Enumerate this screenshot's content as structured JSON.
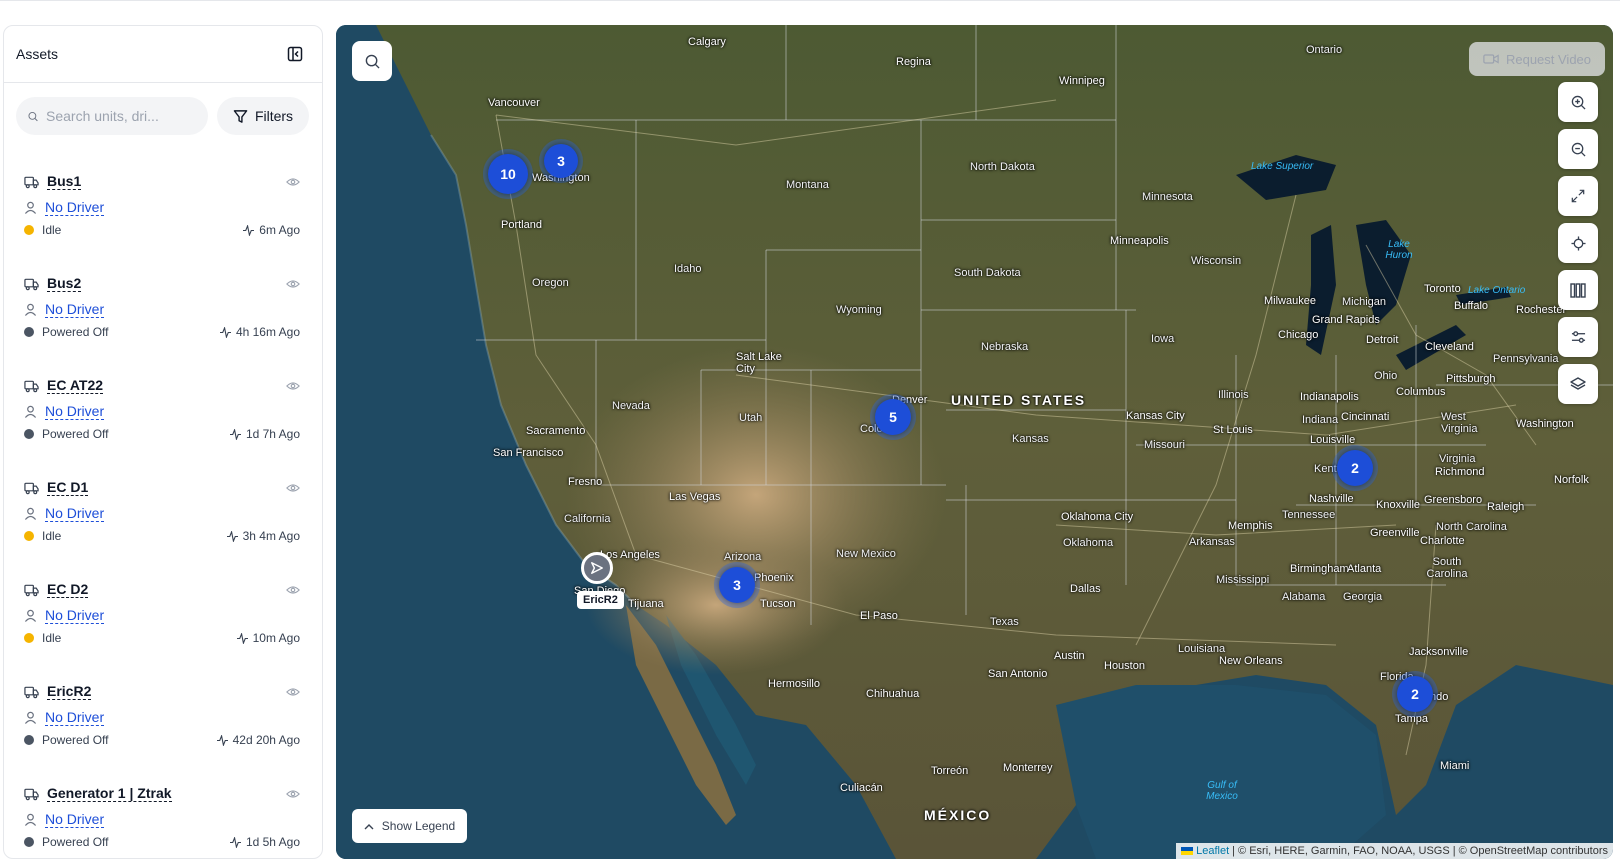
{
  "sidebar": {
    "title": "Assets",
    "search_placeholder": "Search units, dri...",
    "filters_label": "Filters",
    "assets": [
      {
        "name": "Bus1",
        "driver": "No Driver",
        "status": "Idle",
        "ago": "6m Ago"
      },
      {
        "name": "Bus2",
        "driver": "No Driver",
        "status": "Powered Off",
        "ago": "4h 16m Ago"
      },
      {
        "name": "EC AT22",
        "driver": "No Driver",
        "status": "Powered Off",
        "ago": "1d 7h Ago"
      },
      {
        "name": "EC D1",
        "driver": "No Driver",
        "status": "Idle",
        "ago": "3h 4m Ago"
      },
      {
        "name": "EC D2",
        "driver": "No Driver",
        "status": "Idle",
        "ago": "10m Ago"
      },
      {
        "name": "EricR2",
        "driver": "No Driver",
        "status": "Powered Off",
        "ago": "42d 20h Ago"
      },
      {
        "name": "Generator 1 | Ztrak",
        "driver": "No Driver",
        "status": "Powered Off",
        "ago": "1d 5h Ago"
      }
    ],
    "status_colors": {
      "Idle": "#f5b400",
      "Powered Off": "#4b5563"
    }
  },
  "map": {
    "request_video_label": "Request Video",
    "show_legend_label": "Show Legend",
    "vehicle_label": "EricR2",
    "clusters": [
      "10",
      "3",
      "5",
      "2",
      "3",
      "2"
    ],
    "country_label": "UNITED STATES",
    "mexico_label": "MÉXICO",
    "attribution_leaflet": "Leaflet",
    "attribution_text": "| © Esri, HERE, Garmin, FAO, NOAA, USGS | © OpenStreetMap contributors",
    "controls": [
      "zoom-in-icon",
      "zoom-out-icon",
      "fullscreen-icon",
      "locate-icon",
      "map-style-icon",
      "settings-sliders-icon",
      "layers-icon"
    ],
    "places": {
      "calgary": "Calgary",
      "regina": "Regina",
      "winnipeg": "Winnipeg",
      "ontario": "Ontario",
      "vancouver": "Vancouver",
      "washington": "Washington",
      "portland": "Portland",
      "oregon": "Oregon",
      "idaho": "Idaho",
      "montana": "Montana",
      "north_dakota": "North Dakota",
      "minnesota": "Minnesota",
      "lake_superior": "Lake Superior",
      "lake_huron": "Lake Huron",
      "lake_ontario": "Lake Ontario",
      "wyoming": "Wyoming",
      "south_dakota": "South Dakota",
      "wisconsin": "Wisconsin",
      "minneapolis": "Minneapolis",
      "toronto": "Toronto",
      "buffalo": "Buffalo",
      "rochester": "Rochester",
      "milwaukee": "Milwaukee",
      "michigan": "Michigan",
      "grand_rapids": "Grand Rapids",
      "detroit": "Detroit",
      "chicago": "Chicago",
      "cleveland": "Cleveland",
      "pennsylvania": "Pennsylvania",
      "salt_lake_city": "Salt Lake City",
      "nebraska": "Nebraska",
      "iowa": "Iowa",
      "ohio": "Ohio",
      "pittsburgh": "Pittsburgh",
      "illinois": "Illinois",
      "indianapolis": "Indianapolis",
      "columbus": "Columbus",
      "nevada": "Nevada",
      "utah": "Utah",
      "denver": "Denver",
      "colorado": "Colo",
      "kansas_city": "Kansas City",
      "indiana": "Indiana",
      "cincinnati": "Cincinnati",
      "west_virginia": "West Virginia",
      "washington_dc": "Washington",
      "sacramento": "Sacramento",
      "san_francisco": "San Francisco",
      "kansas": "Kansas",
      "missouri": "Missouri",
      "st_louis": "St Louis",
      "louisville": "Louisville",
      "virginia": "Virginia",
      "richmond": "Richmond",
      "kentucky": "Kentucky",
      "fresno": "Fresno",
      "las_vegas": "Las Vegas",
      "nashville": "Nashville",
      "knoxville": "Knoxville",
      "greensboro": "Greensboro",
      "raleigh": "Raleigh",
      "norfolk": "Norfolk",
      "california": "California",
      "oklahoma_city": "Oklahoma City",
      "tennessee": "Tennessee",
      "memphis": "Memphis",
      "north_carolina": "North Carolina",
      "los_angeles": "Los Angeles",
      "oklahoma": "Oklahoma",
      "arkansas": "Arkansas",
      "greenville": "Greenville",
      "charlotte": "Charlotte",
      "arizona": "Arizona",
      "phoenix": "Phoenix",
      "new_mexico": "New Mexico",
      "south_carolina": "South Carolina",
      "san_diego": "San Diego",
      "tijuana": "Tijuana",
      "tucson": "Tucson",
      "el_paso": "El Paso",
      "mississippi": "Mississippi",
      "birmingham": "Birmingham",
      "atlanta": "Atlanta",
      "dallas": "Dallas",
      "alabama": "Alabama",
      "georgia": "Georgia",
      "texas": "Texas",
      "louisiana": "Louisiana",
      "jacksonville": "Jacksonville",
      "austin": "Austin",
      "new_orleans": "New Orleans",
      "hermosillo": "Hermosillo",
      "houston": "Houston",
      "san_antonio": "San Antonio",
      "florida": "Florida",
      "orlando": "ndo",
      "chihuahua": "Chihuahua",
      "tampa": "Tampa",
      "torreon": "Torreón",
      "monterrey": "Monterrey",
      "gulf_of_mexico": "Gulf of Mexico",
      "miami": "Miami",
      "culiacan": "Culiacán"
    }
  }
}
